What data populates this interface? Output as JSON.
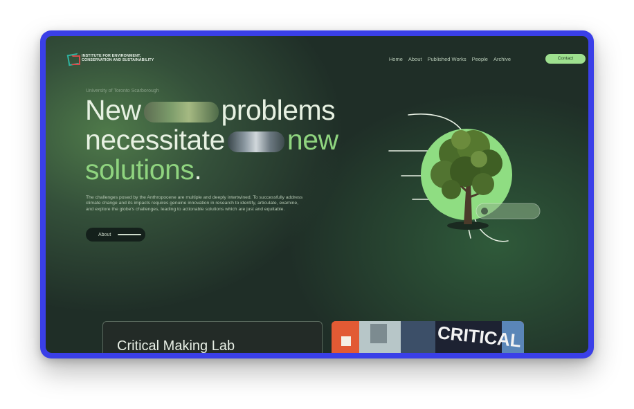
{
  "header": {
    "logo_text": "INSTITUTE FOR ENVIRONMENT, CONSERVATION AND SUSTAINABILITY",
    "nav": [
      "Home",
      "About",
      "Published Works",
      "People",
      "Archive"
    ],
    "contact_label": "Contact"
  },
  "hero": {
    "eyebrow": "University of Toronto Scarborough",
    "line1_a": "New",
    "line1_b": "problems",
    "line2_a": "necessitate",
    "line2_b": "new",
    "line3_a": "solutions",
    "line3_b": ".",
    "lede": "The challenges posed by the Anthropocene are multiple and deeply intertwined. To successfully address climate change and its impacts requires genuine innovation in research to identify, articulate, examine, and explore the globe's challenges, leading to actionable solutions which are just and equitable.",
    "about_label": "About"
  },
  "cards": {
    "lab_title": "Critical Making Lab",
    "photo_text": "CRITICAL"
  },
  "colors": {
    "frame": "#3a3fe8",
    "background": "#1f2e27",
    "accent_green": "#8fd47f",
    "button_green": "#9ee08f"
  }
}
